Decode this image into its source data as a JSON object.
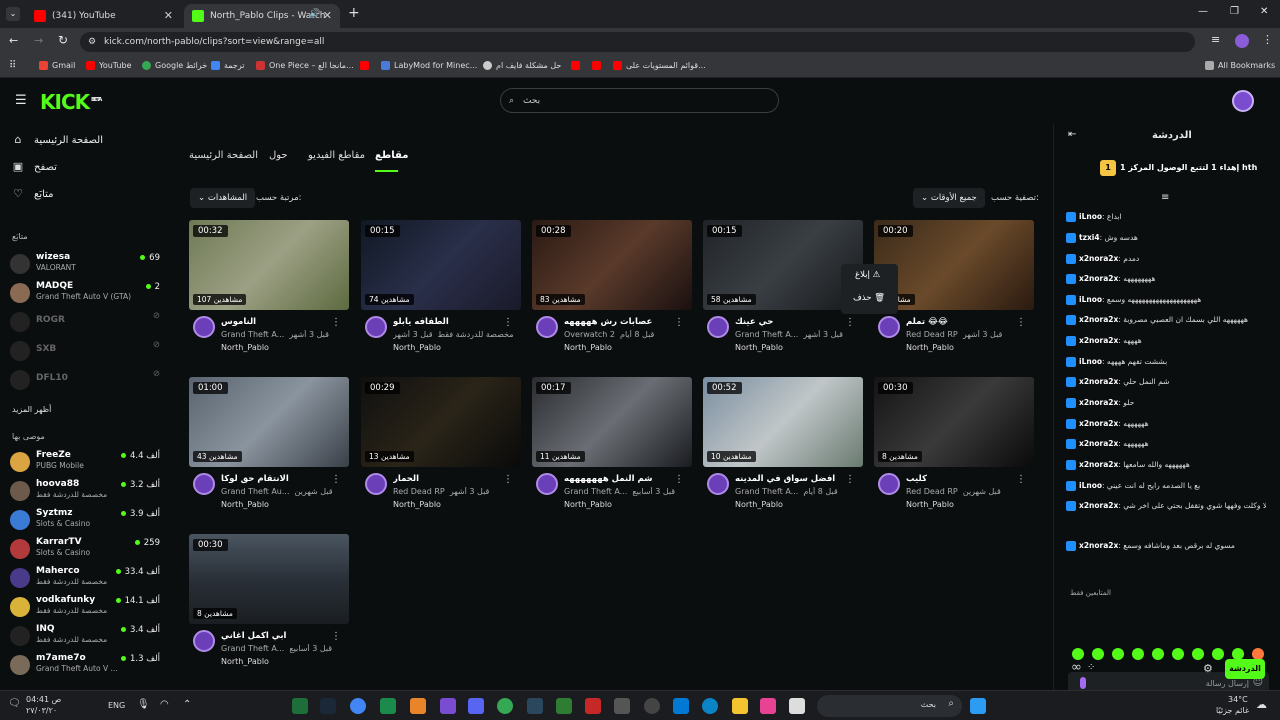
{
  "browser": {
    "tabs": [
      {
        "label": "(341) YouTube",
        "active": false
      },
      {
        "label": "North_Pablo Clips - Watch",
        "active": true
      }
    ],
    "new_tab": "+",
    "url": "kick.com/north-pablo/clips?sort=view&range=all",
    "bookmarks": [
      "Gmail",
      "YouTube",
      "Google خرائط",
      "ترجمة",
      "One Piece – مانجا الع...",
      "LabyMod for Minec...",
      "حل مشكلة فايف ام",
      "قوائم المستويات على..."
    ],
    "all_bookmarks": "All Bookmarks"
  },
  "site": {
    "logo": "KICK",
    "logo_beta": "BETA",
    "search_placeholder": "بحث"
  },
  "sidebar": {
    "nav": [
      {
        "label": "الصفحة الرئيسية",
        "icon": "home-icon"
      },
      {
        "label": "تصفح",
        "icon": "browse-icon"
      },
      {
        "label": "متابَع",
        "icon": "heart-icon"
      }
    ],
    "following_header": "متابَع",
    "following": [
      {
        "name": "wizesa",
        "game": "VALORANT",
        "viewers": "69",
        "online": true
      },
      {
        "name": "MADQE",
        "game": "Grand Theft Auto V (GTA)",
        "viewers": "2",
        "online": true
      },
      {
        "name": "ROGR",
        "game": "",
        "viewers": "",
        "online": false
      },
      {
        "name": "SXB",
        "game": "",
        "viewers": "",
        "online": false
      },
      {
        "name": "DFL10",
        "game": "",
        "viewers": "",
        "online": false
      }
    ],
    "show_more": "أظهر المزيد",
    "recommended_header": "موصى بها",
    "recommended": [
      {
        "name": "FreeZe",
        "game": "PUBG Mobile",
        "viewers": "4.4 ألف"
      },
      {
        "name": "hoova88",
        "game": "مخصصة للدردشة فقط",
        "viewers": "3.2 ألف"
      },
      {
        "name": "Syztmz",
        "game": "Slots & Casino",
        "viewers": "3.9 ألف"
      },
      {
        "name": "KarrarTV",
        "game": "Slots & Casino",
        "viewers": "259"
      },
      {
        "name": "Maherco",
        "game": "مخصصة للدردشة فقط",
        "viewers": "33.4 ألف"
      },
      {
        "name": "vodkafunky",
        "game": "مخصصة للدردشة فقط",
        "viewers": "14.1 ألف"
      },
      {
        "name": "INQ",
        "game": "مخصصة للدردشة فقط",
        "viewers": "3.4 ألف"
      },
      {
        "name": "m7ame7o",
        "game": "Grand Theft Auto V ...",
        "viewers": "1.3 ألف"
      }
    ]
  },
  "main": {
    "tabs": [
      "الصفحة الرئيسية",
      "حول",
      "مقاطع الفيديو",
      "مقاطع"
    ],
    "active_tab": "مقاطع",
    "sort_label": "مرتبة حسب:",
    "sort_value": "المشاهدات",
    "filter_label": "تصفية حسب:",
    "filter_value": "جميع الأوقات",
    "clips": [
      {
        "duration": "00:32",
        "views": "107 مشاهدين",
        "title": "الناموس",
        "game": "Grand Theft A...",
        "age": "قبل 3 أشهر",
        "channel": "North_Pablo"
      },
      {
        "duration": "00:15",
        "views": "74 مشاهدين",
        "title": "الطفافه يابلو",
        "game": "مخصصة للدردشة فقط",
        "age": "قبل 3 أشهر",
        "channel": "North_Pablo"
      },
      {
        "duration": "00:28",
        "views": "83 مشاهدين",
        "title": "عصابات رش هههههه",
        "game": "Overwatch 2",
        "age": "قبل 8 أيام",
        "channel": "North_Pablo"
      },
      {
        "duration": "00:15",
        "views": "58 مشاهدين",
        "title": "حي عينك",
        "game": "Grand Theft A...",
        "age": "قبل 3 أشهر",
        "channel": "North_Pablo"
      },
      {
        "duration": "00:20",
        "views": "مشاهدين",
        "title": "تملم 😂😂",
        "game": "Red Dead RP",
        "age": "قبل 3 أشهر",
        "channel": "North_Pablo"
      },
      {
        "duration": "01:00",
        "views": "43 مشاهدين",
        "title": "الانتقام حق لوكا",
        "game": "Grand Theft Au...",
        "age": "قبل شهرين",
        "channel": "North_Pablo"
      },
      {
        "duration": "00:29",
        "views": "13 مشاهدين",
        "title": "الحمار",
        "game": "Red Dead RP",
        "age": "قبل 3 أشهر",
        "channel": "North_Pablo"
      },
      {
        "duration": "00:17",
        "views": "11 مشاهدين",
        "title": "شم النمل هههههههه",
        "game": "Grand Theft A...",
        "age": "قبل 3 أسابيع",
        "channel": "North_Pablo"
      },
      {
        "duration": "00:52",
        "views": "10 مشاهدين",
        "title": "افضل سواق في المدينه",
        "game": "Grand Theft A...",
        "age": "قبل 8 أيام",
        "channel": "North_Pablo"
      },
      {
        "duration": "00:30",
        "views": "8 مشاهدين",
        "title": "كليب",
        "game": "Red Dead RP",
        "age": "قبل شهرين",
        "channel": "North_Pablo"
      },
      {
        "duration": "00:30",
        "views": "8 مشاهدين",
        "title": "ابي اكمل اغاني",
        "game": "Grand Theft A...",
        "age": "قبل 3 أسابيع",
        "channel": "North_Pablo"
      }
    ],
    "context_menu": {
      "report": "إبلاغ",
      "delete": "حذف"
    }
  },
  "chat": {
    "title": "الدردشة",
    "pinned": "إهداء 1 لتتبع الوصول المركز 1 hth",
    "pinned_rank": "1",
    "messages": [
      {
        "user": "iLnoo",
        "text": "ابداع"
      },
      {
        "user": "tzxi4",
        "text": "هدسه وش"
      },
      {
        "user": "x2nora2x",
        "text": "دمدم"
      },
      {
        "user": "x2nora2x",
        "text": "ههههههههه"
      },
      {
        "user": "iLnoo",
        "text": "ههههههههههههههههههههه وسمع"
      },
      {
        "user": "x2nora2x",
        "text": "ههههههه اللي بسمك ان العصبي مصروبة"
      },
      {
        "user": "x2nora2x",
        "text": "ههههه"
      },
      {
        "user": "iLnoo",
        "text": "بششت تفهم ههههه"
      },
      {
        "user": "x2nora2x",
        "text": "شم النمل حلي"
      },
      {
        "user": "x2nora2x",
        "text": "حلو"
      },
      {
        "user": "x2nora2x",
        "text": "ههههههه"
      },
      {
        "user": "x2nora2x",
        "text": "ههههههه"
      },
      {
        "user": "x2nora2x",
        "text": "ههههههه والله سامعها"
      },
      {
        "user": "iLnoo",
        "text": "بع يا الصدمه رايح له انت عيني"
      },
      {
        "user": "x2nora2x",
        "text": "لا وكلت وفهها شوي وتقفل بحتي على اخر شي"
      },
      {
        "user": "x2nora2x",
        "text": "مسوي له برقص بعد وماشافه وسمع"
      }
    ],
    "followers_only": "المتابعين فقط",
    "input_placeholder": "إرسال رسالة",
    "send_button": "الدردشة"
  },
  "taskbar": {
    "lang": "ENG",
    "time": "04:41 ص",
    "date": "٢٧/٠٣/٢٠",
    "weather": "34°C",
    "weather_desc": "غائم جزئيًا",
    "search": "بحث"
  }
}
